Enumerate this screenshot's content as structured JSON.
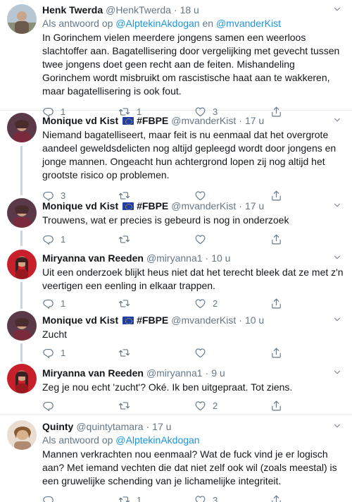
{
  "tweets": [
    {
      "name": "Henk Twerda",
      "handle": "@HenkTwerda",
      "time": "18 u",
      "reply_prefix": "Als antwoord op",
      "reply_mention1": "@AlptekinAkdogan",
      "reply_joiner": "en",
      "reply_mention2": "@mvanderKist",
      "text": "In Gorinchem vielen meerdere jongens samen een weerloos slachtoffer aan. Bagatellisering door vergelijking met gevecht tussen twee jongens doet geen recht aan de feiten. Mishandeling Gorinchem wordt misbruikt om rascistische haat aan te wakkeren, maar bagatellisering is ook fout.",
      "replies": "1",
      "retweets": "1",
      "likes": "3"
    },
    {
      "name": "Monique vd Kist",
      "badge": "#FBPE",
      "handle": "@mvanderKist",
      "time": "17 u",
      "text": "Niemand bagatelliseert, maar feit is nu eenmaal dat het overgrote aandeel geweldsdelicten nog altijd gepleegd wordt door jongens en jonge mannen. Ongeacht hun achtergrond lopen zij nog altijd het grootste risico op problemen.",
      "replies": "3",
      "retweets": "",
      "likes": ""
    },
    {
      "name": "Monique vd Kist",
      "badge": "#FBPE",
      "handle": "@mvanderKist",
      "time": "17 u",
      "text": "Trouwens, wat er precies is gebeurd is nog in onderzoek",
      "replies": "1",
      "retweets": "",
      "likes": ""
    },
    {
      "name": "Miryanna van Reeden",
      "handle": "@miryanna1",
      "time": "10 u",
      "text": "Uit een onderzoek blijkt heus niet dat het terecht bleek dat ze met z'n veertigen een eenling in elkaar trappen.",
      "replies": "1",
      "retweets": "",
      "likes": "2"
    },
    {
      "name": "Monique vd Kist",
      "badge": "#FBPE",
      "handle": "@mvanderKist",
      "time": "10 u",
      "text": "Zucht",
      "replies": "1",
      "retweets": "",
      "likes": ""
    },
    {
      "name": "Miryanna van Reeden",
      "handle": "@miryanna1",
      "time": "9 u",
      "text": "Zeg je nou echt 'zucht'? Oké. Ik ben uitgepraat. Tot ziens.",
      "replies": "",
      "retweets": "",
      "likes": "2"
    },
    {
      "name": "Quinty",
      "handle": "@quintytamara",
      "time": "17 u",
      "reply_prefix": "Als antwoord op",
      "reply_mention1": "@AlptekinAkdogan",
      "text": "Mannen verkrachten nou eenmaal? Wat de fuck vind je er logisch aan? Met iemand vechten die dat niet zelf ook wil (zoals meestal) is een gruwelijke schending van je lichamelijke integriteit.",
      "replies": "",
      "retweets": "1",
      "likes": "3"
    }
  ],
  "colors": {
    "text": "#14171a",
    "muted": "#657786",
    "link": "#1b95e0",
    "thread": "#ccd6dd",
    "separator": "#e6ecf0"
  },
  "icons": [
    "reply-icon",
    "retweet-icon",
    "like-icon",
    "share-icon",
    "chevron-down-icon",
    "eu-flag-icon"
  ]
}
